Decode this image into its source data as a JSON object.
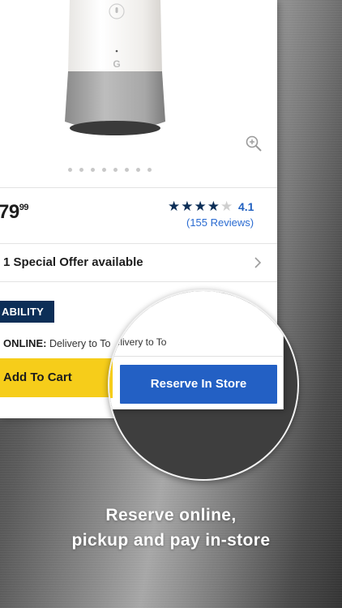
{
  "product": {
    "price_main": "79",
    "price_cents": "99",
    "rating": "4.1",
    "rating_fraction": 0.82,
    "reviews": "(155 Reviews)",
    "image_dots": 8
  },
  "offer": {
    "label": "1 Special Offer available"
  },
  "availability": {
    "badge": "ABILITY",
    "online_label": "ONLINE:",
    "online_text": "Delivery to To"
  },
  "actions": {
    "add_to_cart": "Add To Cart",
    "reserve_in_store": "Reserve In Store"
  },
  "caption": {
    "line1": "Reserve online,",
    "line2": "pickup and pay in-store"
  },
  "colors": {
    "star": "#0c2e57",
    "star_empty": "#cfcfcf",
    "link_blue": "#2a6bd1",
    "reserve_button": "#2360c4",
    "cart_button": "#f6cd1a",
    "badge_bg": "#0c2e57"
  },
  "icons": {
    "zoom": "zoom-in-icon",
    "chevron": "chevron-right-icon",
    "mic": "microphone-icon"
  }
}
